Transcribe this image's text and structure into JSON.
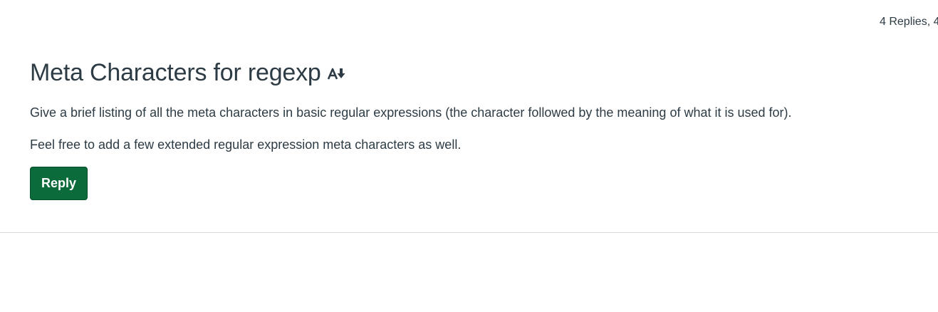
{
  "header": {
    "replies_count": "4 Replies, 4"
  },
  "topic": {
    "title": "Meta Characters for regexp",
    "translate_icon": "translate-icon",
    "paragraphs": [
      "Give a brief listing of all the meta characters in basic regular expressions (the character followed by the meaning of what it is used for).",
      "Feel free to add a few extended regular expression meta characters as well."
    ],
    "reply_label": "Reply"
  },
  "colors": {
    "reply_button": "#0b6b3a",
    "text": "#2d3b45",
    "divider": "#d7dadd"
  }
}
